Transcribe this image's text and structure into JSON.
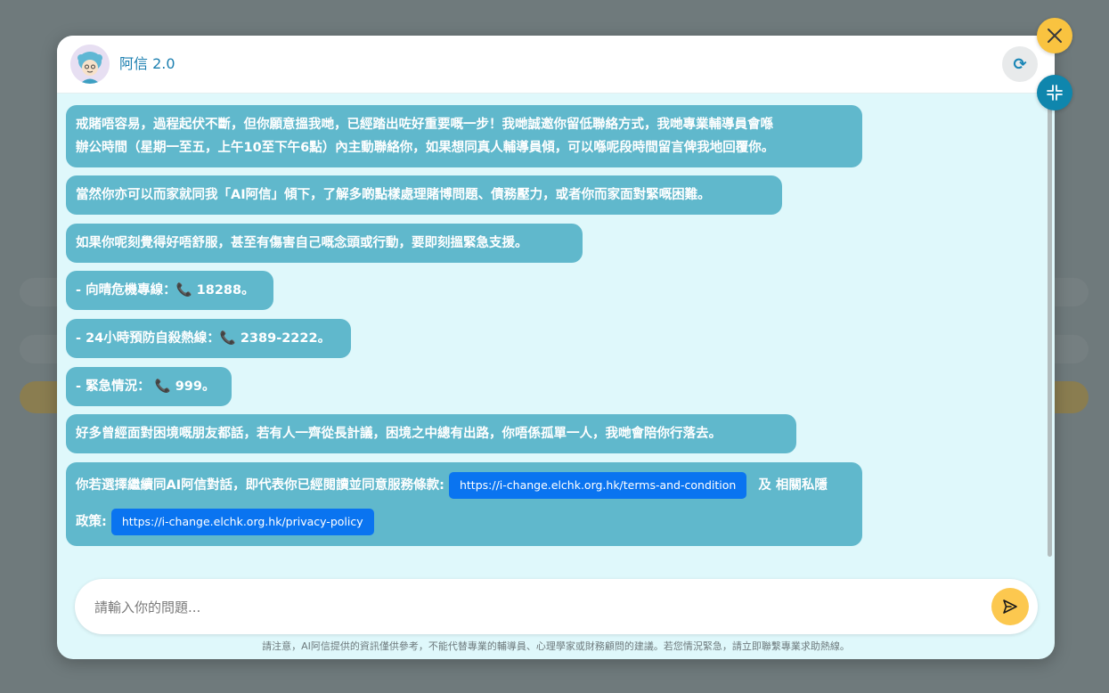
{
  "header": {
    "title": "阿信 2.0",
    "avatar_icon": "bot-avatar-icon",
    "refresh_icon": "refresh-icon",
    "refresh_glyph": "⟳"
  },
  "messages": [
    {
      "lines": [
        "戒賭唔容易，過程起伏不斷，但你願意搵我哋，已經踏出咗好重要嘅一步！我哋誠邀你留低聯絡方式，我哋專業輔導員會喺",
        "辦公時間（星期一至五，上午10至下午6點）內主動聯絡你，如果想同真人輔導員傾，可以喺呢段時間留言俾我地回覆你。"
      ]
    },
    {
      "lines": [
        "當然你亦可以而家就同我「AI阿信」傾下，了解多啲點樣處理賭博問題、債務壓力，或者你而家面對緊嘅困難。"
      ]
    },
    {
      "lines": [
        "如果你呢刻覺得好唔舒服，甚至有傷害自己嘅念頭或行動，要即刻搵緊急支援。"
      ]
    },
    {
      "lines": [
        "- 向晴危機專線：📞 18288。"
      ]
    },
    {
      "lines": [
        "- 24小時預防自殺熱線：📞 2389-2222。"
      ]
    },
    {
      "lines": [
        "- 緊急情況： 📞 999。"
      ]
    },
    {
      "lines": [
        "好多曾經面對困境嘅朋友都話，若有人一齊從長計議，困境之中總有出路，你唔係孤單一人，我哋會陪你行落去。"
      ]
    }
  ],
  "terms_message": {
    "prefix": "你若選擇繼續同AI阿信對話，即代表你已經閱讀並同意服務條款:",
    "terms_link": "https://i-change.elchk.org.hk/terms-and-condition",
    "middle": "及 相關私隱",
    "line2_prefix": "政策:",
    "privacy_link": "https://i-change.elchk.org.hk/privacy-policy"
  },
  "input": {
    "placeholder": "請輸入你的問題...",
    "value": ""
  },
  "disclaimer": "請注意，AI阿信提供的資訊僅供參考，不能代替專業的輔導員、心理學家或財務顧問的建議。若您情況緊急，請立即聯繫專業求助熱線。",
  "icons": {
    "send": "send-icon",
    "close": "close-icon",
    "minimize": "minimize-icon"
  },
  "colors": {
    "bubble": "#60b8cc",
    "panel": "#dff8fb",
    "accent_yellow": "#f9c340",
    "accent_teal": "#0f86ad",
    "link": "#0a74f0"
  }
}
